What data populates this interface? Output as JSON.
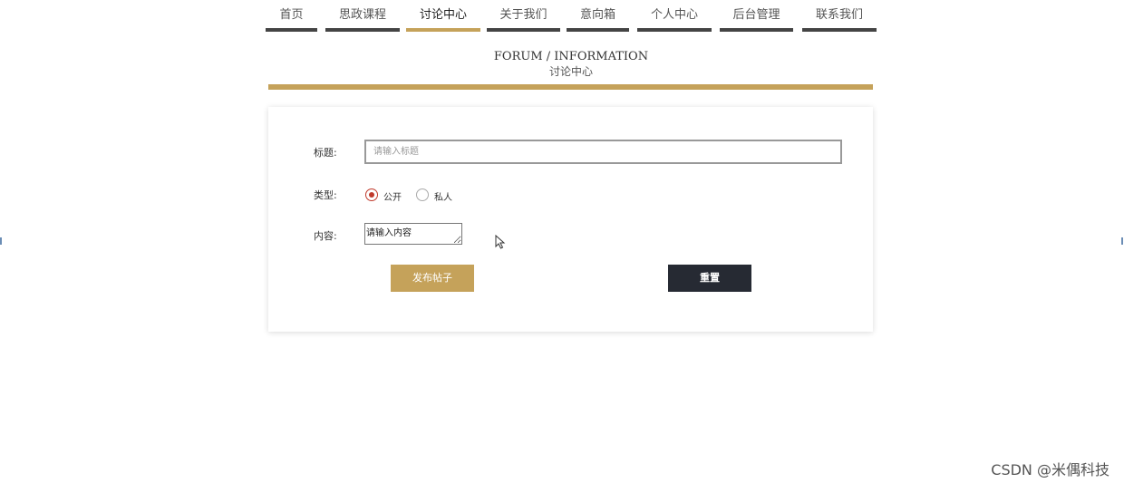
{
  "nav": {
    "items": [
      {
        "label": "首页"
      },
      {
        "label": "思政课程"
      },
      {
        "label": "讨论中心"
      },
      {
        "label": "关于我们"
      },
      {
        "label": "意向箱"
      },
      {
        "label": "个人中心"
      },
      {
        "label": "后台管理"
      },
      {
        "label": "联系我们"
      }
    ],
    "active": "讨论中心"
  },
  "section": {
    "title_en": "FORUM / INFORMATION",
    "title_cn": "讨论中心"
  },
  "form": {
    "title_label": "标题:",
    "title_placeholder": "请输入标题",
    "type_label": "类型:",
    "type_options": [
      {
        "label": "公开",
        "checked": true
      },
      {
        "label": "私人",
        "checked": false
      }
    ],
    "content_label": "内容:",
    "content_value": "请输入内容",
    "submit_label": "发布帖子",
    "reset_label": "重置"
  },
  "watermark": "CSDN @米偶科技",
  "colors": {
    "accent": "#c5a25a",
    "nav_bar": "#444444",
    "reset_button": "#262a33",
    "radio_checked": "#c0392b"
  }
}
